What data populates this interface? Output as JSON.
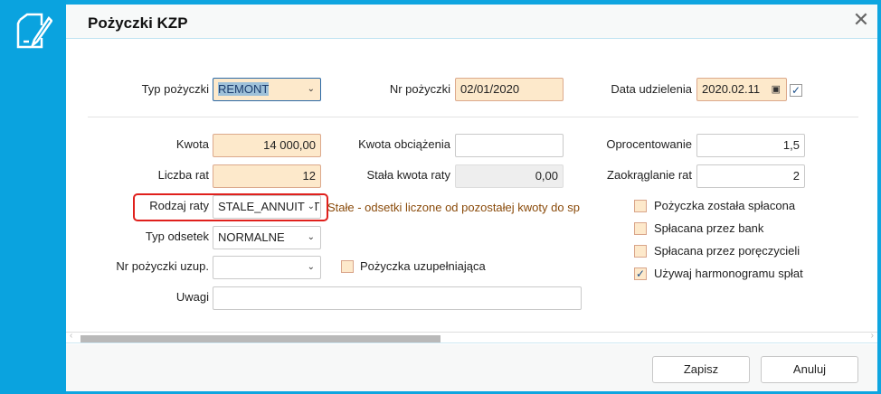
{
  "dialog": {
    "title": "Pożyczki KZP"
  },
  "header_row": {
    "typ_pozyczki": {
      "label": "Typ pożyczki",
      "value": "REMONT"
    },
    "nr_pozyczki": {
      "label": "Nr pożyczki",
      "value": "02/01/2020"
    },
    "data_udzielenia": {
      "label": "Data udzielenia",
      "value": "2020.02.11",
      "checked": true
    }
  },
  "left": {
    "kwota": {
      "label": "Kwota",
      "value": "14 000,00"
    },
    "liczba_rat": {
      "label": "Liczba rat",
      "value": "12"
    },
    "rodzaj_raty": {
      "label": "Rodzaj raty",
      "value": "STALE_ANNUITET",
      "hint": "Stałe - odsetki liczone od pozostałej kwoty do sp"
    },
    "typ_odsetek": {
      "label": "Typ odsetek",
      "value": "NORMALNE"
    },
    "nr_uzup": {
      "label": "Nr pożyczki uzup.",
      "value": ""
    },
    "uzupelniajaca": {
      "label": "Pożyczka uzupełniająca",
      "checked": false
    },
    "uwagi": {
      "label": "Uwagi",
      "value": ""
    }
  },
  "middle": {
    "kwota_obciazenia": {
      "label": "Kwota obciążenia",
      "value": ""
    },
    "stala_kwota": {
      "label": "Stała kwota raty",
      "value": "0,00"
    }
  },
  "right": {
    "oprocentowanie": {
      "label": "Oprocentowanie",
      "value": "1,5"
    },
    "zaokraglanie": {
      "label": "Zaokrąglanie rat",
      "value": "2"
    },
    "checkboxes": [
      {
        "label": "Pożyczka została spłacona",
        "checked": false
      },
      {
        "label": "Spłacana przez bank",
        "checked": false
      },
      {
        "label": "Spłacana przez poręczycieli",
        "checked": false
      },
      {
        "label": "Używaj harmonogramu spłat",
        "checked": true
      }
    ]
  },
  "footer": {
    "save": "Zapisz",
    "cancel": "Anuluj"
  },
  "colors": {
    "accent": "#0aa3df",
    "required_bg": "#fde9cb",
    "highlight": "#e0201c",
    "hint": "#8a4b0b"
  }
}
